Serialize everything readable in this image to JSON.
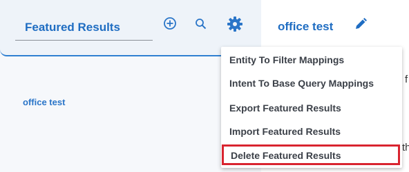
{
  "left_panel": {
    "header_title": "Featured Results",
    "items": [
      "office test"
    ]
  },
  "right_panel": {
    "title": "office test",
    "background_fragments": [
      "f",
      "th"
    ]
  },
  "menu": {
    "items": [
      {
        "label": "Entity To Filter Mappings"
      },
      {
        "label": "Intent To Base Query Mappings"
      },
      {
        "label": "Export Featured Results"
      },
      {
        "label": "Import Featured Results"
      },
      {
        "label": "Delete Featured Results",
        "highlighted": true
      }
    ]
  },
  "colors": {
    "accent": "#1f6dc2",
    "highlight_border": "#d9242f"
  },
  "icons": [
    "add-circle-icon",
    "search-icon",
    "gear-icon",
    "pencil-icon"
  ]
}
